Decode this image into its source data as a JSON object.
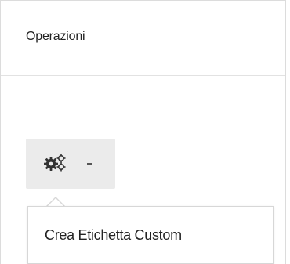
{
  "panel": {
    "title": "Operazioni"
  },
  "actions_menu": {
    "button_icon": "gears-icon",
    "caret_icon": "caret-down-icon",
    "items": [
      {
        "label": "Crea Etichetta Custom"
      }
    ]
  }
}
